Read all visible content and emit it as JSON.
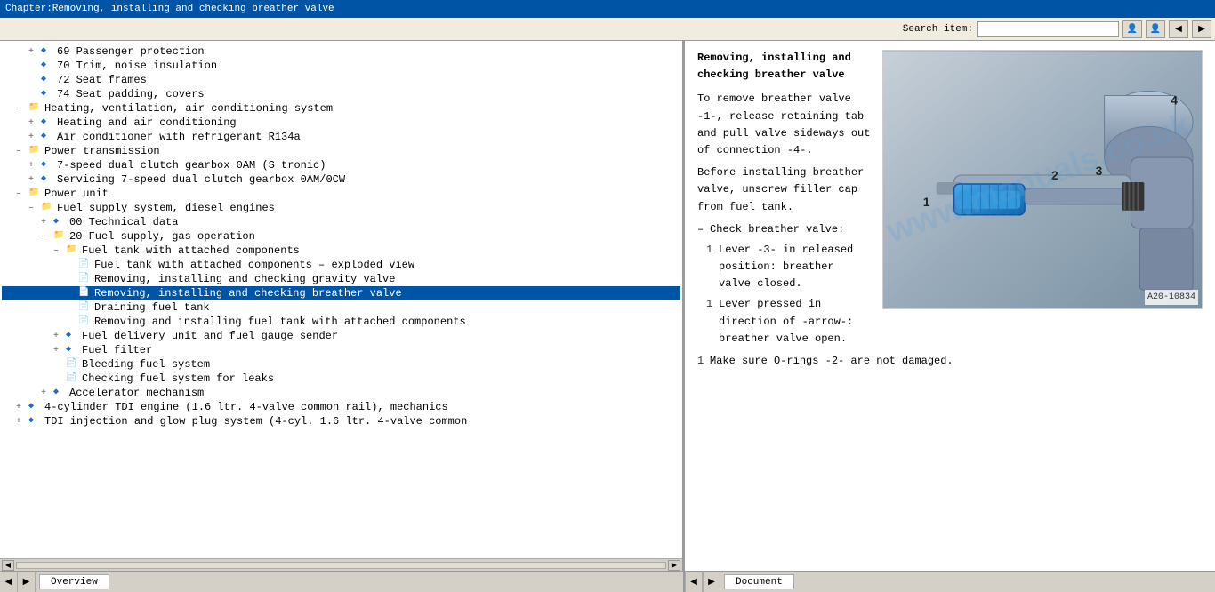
{
  "titlebar": {
    "text": "Chapter:Removing, installing and checking breather valve"
  },
  "toolbar": {
    "search_label": "Search item:",
    "search_placeholder": "",
    "btn_user1": "👤",
    "btn_user2": "👤",
    "btn_nav1": "◀",
    "btn_nav2": "▶"
  },
  "tree": {
    "items": [
      {
        "level": 1,
        "indent": 30,
        "type": "diamond",
        "expander": "+",
        "label": "69 Passenger protection",
        "selected": false
      },
      {
        "level": 1,
        "indent": 30,
        "type": "diamond",
        "expander": "",
        "label": "70 Trim, noise insulation",
        "selected": false
      },
      {
        "level": 1,
        "indent": 30,
        "type": "diamond",
        "expander": "",
        "label": "72 Seat frames",
        "selected": false
      },
      {
        "level": 1,
        "indent": 30,
        "type": "diamond",
        "expander": "",
        "label": "74 Seat padding, covers",
        "selected": false
      },
      {
        "level": 0,
        "indent": 16,
        "type": "book",
        "expander": "–",
        "label": "Heating, ventilation, air conditioning system",
        "selected": false
      },
      {
        "level": 1,
        "indent": 30,
        "type": "diamond",
        "expander": "+",
        "label": "Heating and air conditioning",
        "selected": false
      },
      {
        "level": 1,
        "indent": 30,
        "type": "diamond",
        "expander": "+",
        "label": "Air conditioner with refrigerant R134a",
        "selected": false
      },
      {
        "level": 0,
        "indent": 16,
        "type": "book",
        "expander": "–",
        "label": "Power transmission",
        "selected": false
      },
      {
        "level": 1,
        "indent": 30,
        "type": "diamond",
        "expander": "+",
        "label": "7-speed dual clutch gearbox 0AM (S tronic)",
        "selected": false
      },
      {
        "level": 1,
        "indent": 30,
        "type": "diamond",
        "expander": "+",
        "label": "Servicing 7-speed dual clutch gearbox 0AM/0CW",
        "selected": false
      },
      {
        "level": 0,
        "indent": 16,
        "type": "book",
        "expander": "–",
        "label": "Power unit",
        "selected": false
      },
      {
        "level": 1,
        "indent": 30,
        "type": "book",
        "expander": "–",
        "label": "Fuel supply system, diesel engines",
        "selected": false
      },
      {
        "level": 2,
        "indent": 44,
        "type": "diamond",
        "expander": "+",
        "label": "00 Technical data",
        "selected": false
      },
      {
        "level": 2,
        "indent": 44,
        "type": "book",
        "expander": "–",
        "label": "20 Fuel supply, gas operation",
        "selected": false
      },
      {
        "level": 3,
        "indent": 58,
        "type": "book",
        "expander": "–",
        "label": "Fuel tank with attached components",
        "selected": false
      },
      {
        "level": 4,
        "indent": 72,
        "type": "doc",
        "expander": "",
        "label": "Fuel tank with attached components – exploded view",
        "selected": false
      },
      {
        "level": 4,
        "indent": 72,
        "type": "doc",
        "expander": "",
        "label": "Removing, installing and checking gravity valve",
        "selected": false
      },
      {
        "level": 4,
        "indent": 72,
        "type": "doc",
        "expander": "",
        "label": "Removing, installing and checking breather valve",
        "selected": true
      },
      {
        "level": 4,
        "indent": 72,
        "type": "doc",
        "expander": "",
        "label": "Draining fuel tank",
        "selected": false
      },
      {
        "level": 4,
        "indent": 72,
        "type": "doc",
        "expander": "",
        "label": "Removing and installing fuel tank with attached components",
        "selected": false
      },
      {
        "level": 3,
        "indent": 58,
        "type": "diamond",
        "expander": "+",
        "label": "Fuel delivery unit and fuel gauge sender",
        "selected": false
      },
      {
        "level": 3,
        "indent": 58,
        "type": "diamond",
        "expander": "+",
        "label": "Fuel filter",
        "selected": false
      },
      {
        "level": 3,
        "indent": 58,
        "type": "doc",
        "expander": "",
        "label": "Bleeding fuel system",
        "selected": false
      },
      {
        "level": 3,
        "indent": 58,
        "type": "doc",
        "expander": "",
        "label": "Checking fuel system for leaks",
        "selected": false
      },
      {
        "level": 2,
        "indent": 44,
        "type": "diamond",
        "expander": "+",
        "label": "Accelerator mechanism",
        "selected": false
      },
      {
        "level": 0,
        "indent": 16,
        "type": "diamond",
        "expander": "+",
        "label": "4-cylinder TDI engine (1.6 ltr. 4-valve common rail), mechanics",
        "selected": false
      },
      {
        "level": 0,
        "indent": 16,
        "type": "diamond",
        "expander": "+",
        "label": "TDI injection and glow plug system (4-cyl. 1.6 ltr. 4-valve common",
        "selected": false
      }
    ]
  },
  "document": {
    "title": "Removing, installing and\nchecking breather valve",
    "image_label": "A20-10834",
    "watermark": "www.manuals.co.uk",
    "numbers_on_image": [
      "1",
      "2",
      "3",
      "4"
    ],
    "paragraphs": [
      {
        "type": "text",
        "content": "To remove breather valve -1-, release retaining tab and pull valve sideways out of connection -4-."
      },
      {
        "type": "text",
        "content": "Before installing breather valve, unscrew filler cap from fuel tank."
      },
      {
        "type": "bullet",
        "content": "Check breather valve:"
      },
      {
        "type": "numbered",
        "num": "",
        "content": "Lever -3- in released position: breather valve closed."
      },
      {
        "type": "numbered",
        "num": "",
        "content": "Lever pressed in direction of -arrow-: breather valve open."
      },
      {
        "type": "numbered",
        "num": "",
        "content": "Make sure O-rings -2- are not damaged."
      }
    ]
  },
  "statusbar": {
    "left_tab": "Overview",
    "right_tab": "Document"
  }
}
